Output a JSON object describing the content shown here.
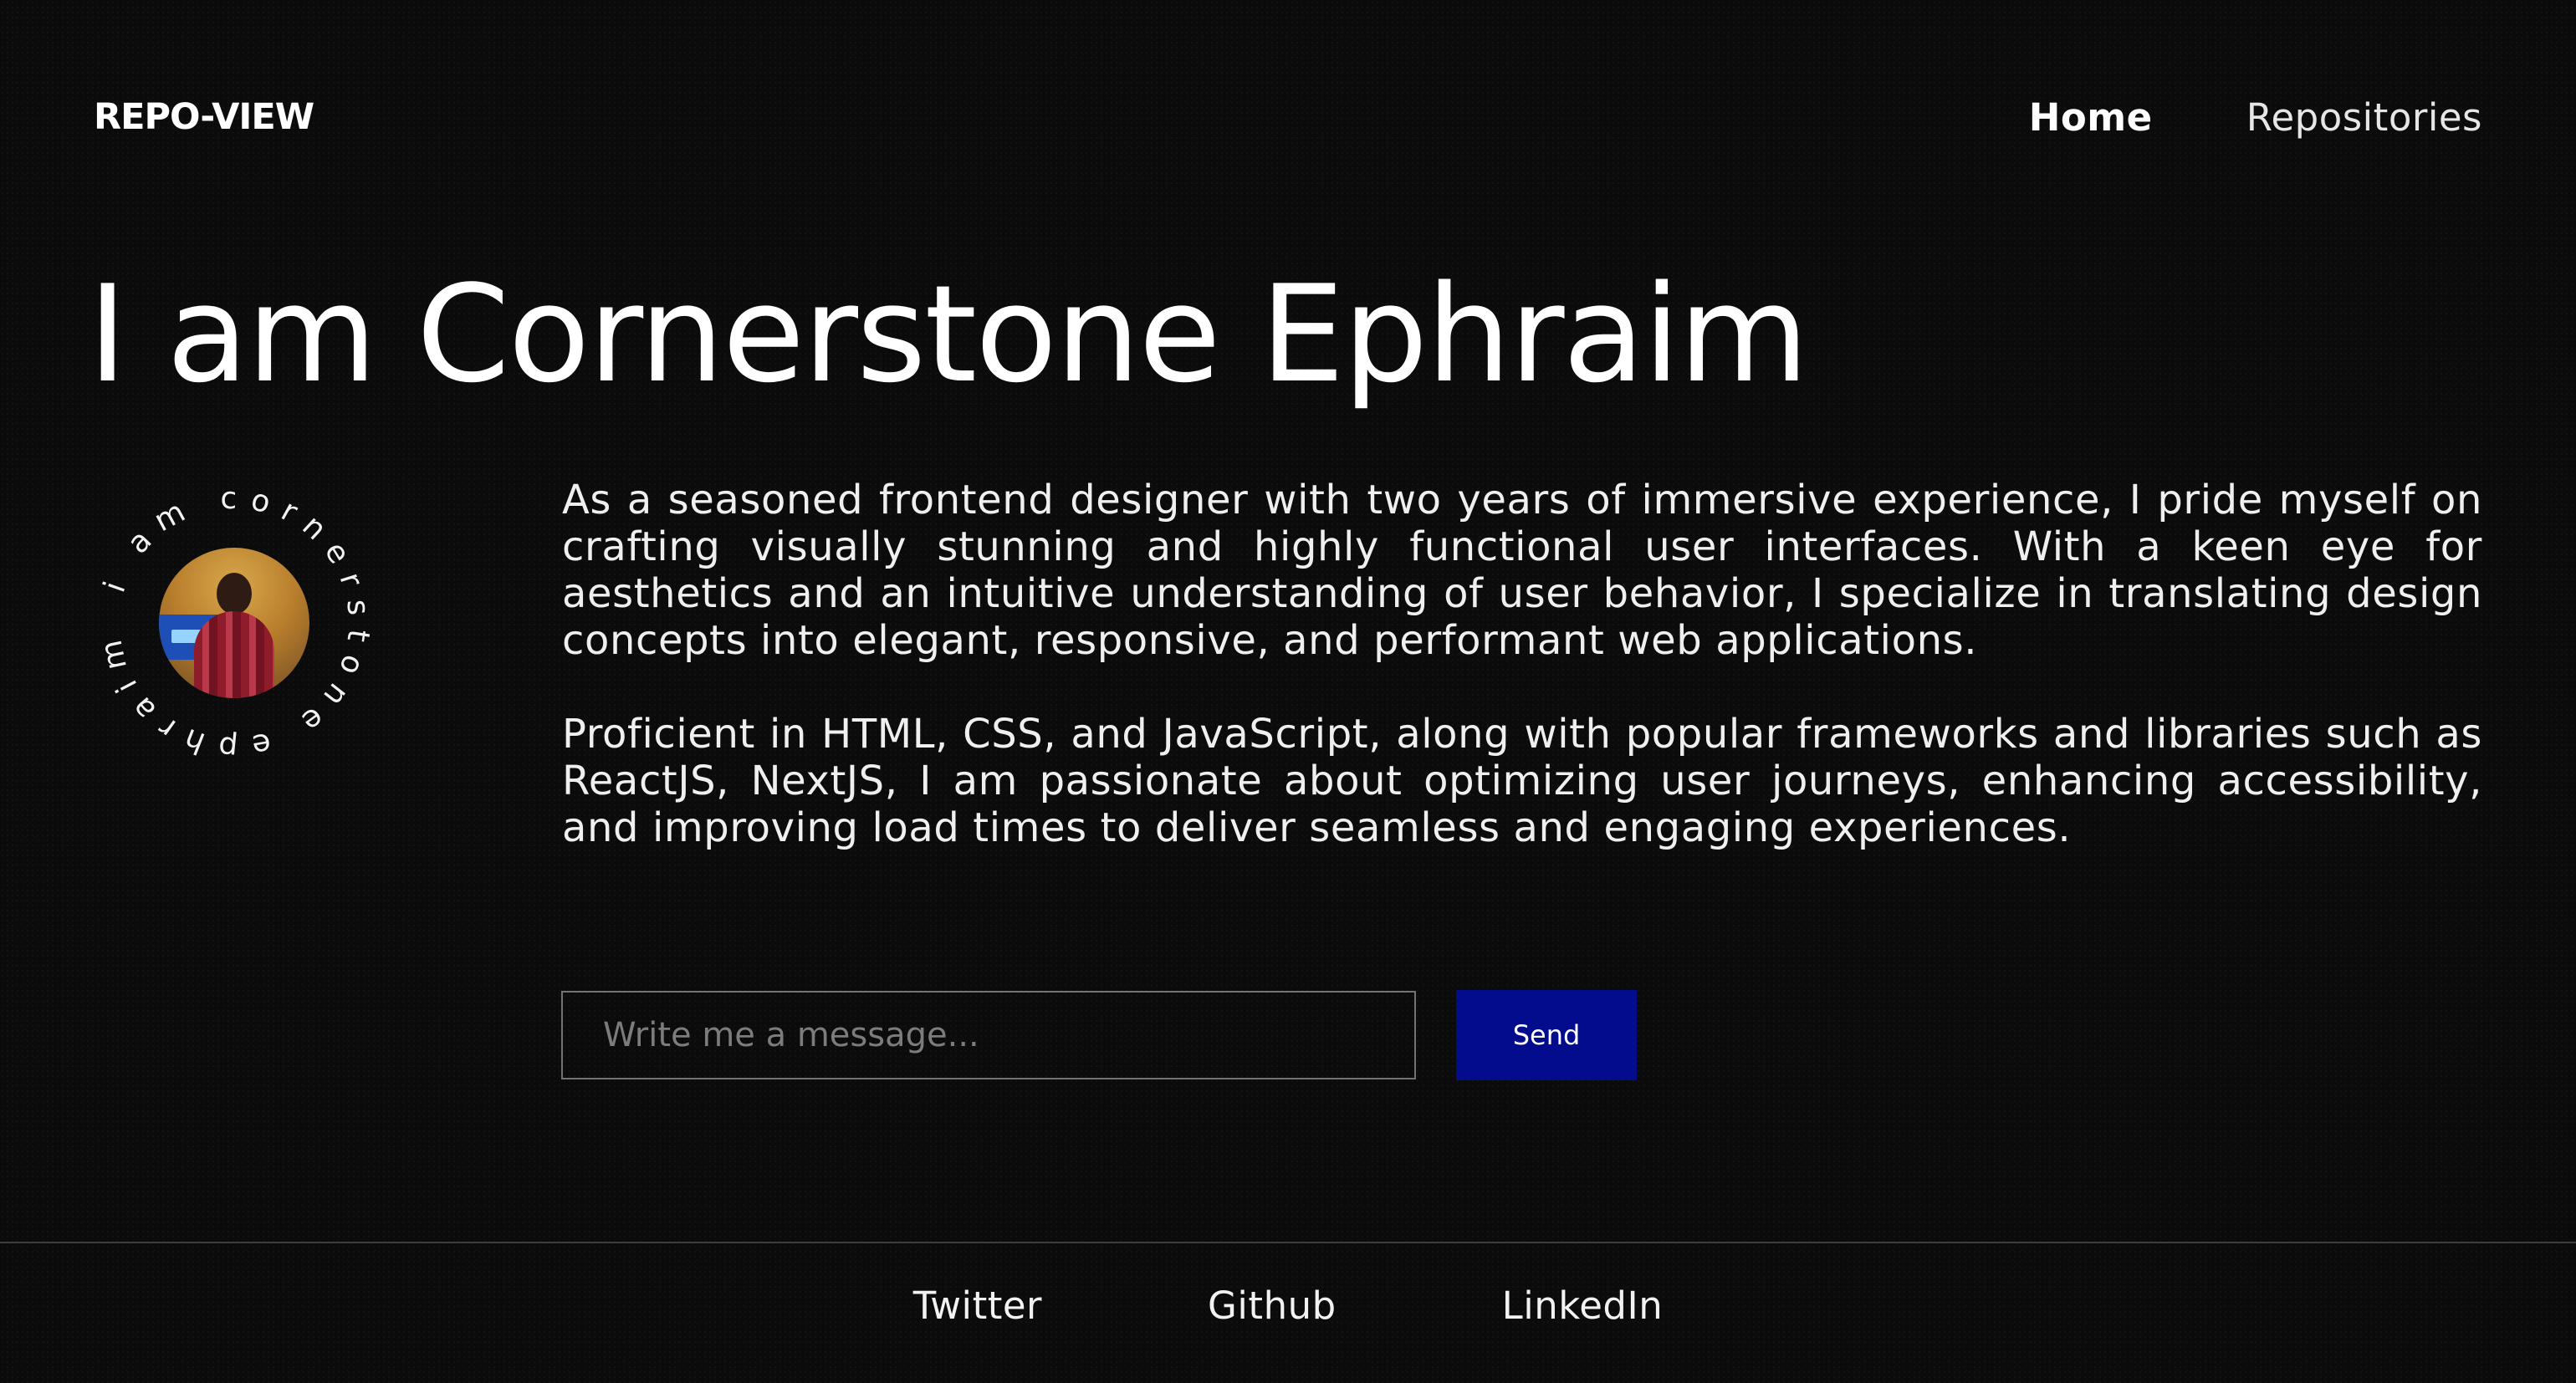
{
  "nav": {
    "brand": "REPO-VIEW",
    "links": [
      {
        "label": "Home",
        "active": true
      },
      {
        "label": "Repositories",
        "active": false
      }
    ]
  },
  "hero": {
    "title": "I am Cornerstone Ephraim"
  },
  "avatar": {
    "ring_text": "i am cornerstone ephraim * "
  },
  "bio": {
    "paragraphs": [
      "As a seasoned frontend designer with two years of immersive experience, I pride myself on crafting visually stunning and highly functional user interfaces. With a keen eye for aesthetics and an intuitive understanding of user behavior, I specialize in translating design concepts into elegant, responsive, and performant web applications.",
      "Proficient in HTML, CSS, and JavaScript, along with popular frameworks and libraries such as ReactJS, NextJS, I am passionate about optimizing user journeys, enhancing accessibility, and improving load times to deliver seamless and engaging experiences."
    ]
  },
  "contact": {
    "placeholder": "Write me a message...",
    "value": "",
    "button_label": "Send"
  },
  "footer": {
    "links": [
      "Twitter",
      "Github",
      "LinkedIn"
    ]
  },
  "colors": {
    "background": "#0b0b0b",
    "text": "#ffffff",
    "accent": "#030c8c",
    "border": "#737373"
  }
}
